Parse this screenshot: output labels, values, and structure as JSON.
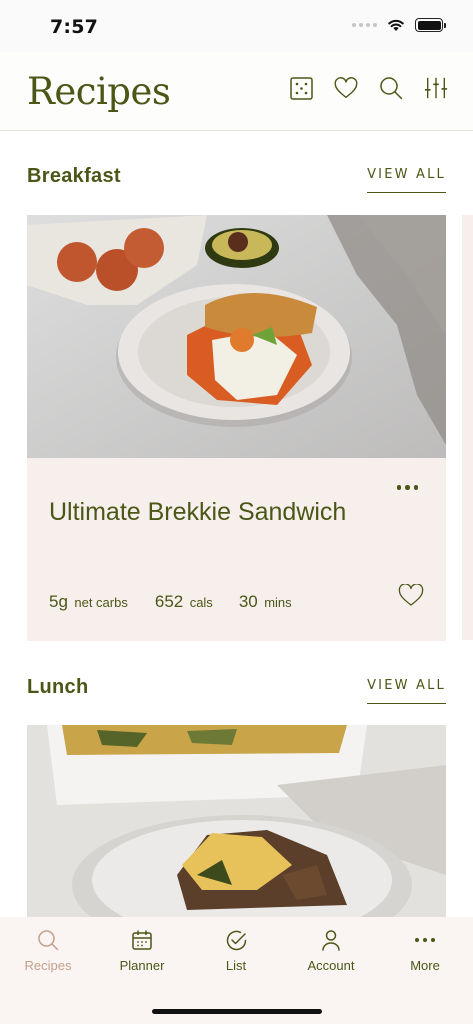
{
  "status": {
    "time": "7:57"
  },
  "header": {
    "title": "Recipes",
    "icons": [
      "dice-icon",
      "heart-icon",
      "search-icon",
      "sliders-icon"
    ]
  },
  "sections": [
    {
      "title": "Breakfast",
      "view_all": "VIEW ALL",
      "card": {
        "name": "Ultimate Brekkie Sandwich",
        "carbs_value": "5g",
        "carbs_unit": "net carbs",
        "cals_value": "652",
        "cals_unit": "cals",
        "time_value": "30",
        "time_unit": "mins"
      }
    },
    {
      "title": "Lunch",
      "view_all": "VIEW ALL"
    }
  ],
  "tabs": [
    {
      "label": "Recipes",
      "icon": "search-icon",
      "active": true
    },
    {
      "label": "Planner",
      "icon": "calendar-icon",
      "active": false
    },
    {
      "label": "List",
      "icon": "check-circle-icon",
      "active": false
    },
    {
      "label": "Account",
      "icon": "person-icon",
      "active": false
    },
    {
      "label": "More",
      "icon": "more-dots-icon",
      "active": false
    }
  ],
  "colors": {
    "brand_green": "#4b5717",
    "card_bg": "#f7efec",
    "tab_active": "#c5a08a"
  }
}
